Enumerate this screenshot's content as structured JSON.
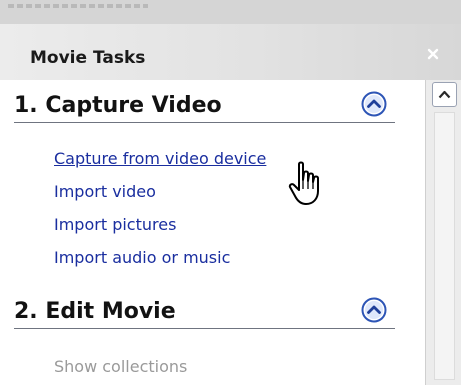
{
  "panel": {
    "title": "Movie Tasks",
    "close_glyph": "×"
  },
  "sections": [
    {
      "title": "1. Capture Video",
      "toggle_icon": "chevron-up-circle-icon",
      "tasks": [
        {
          "label": "Capture from video device",
          "state": "hover"
        },
        {
          "label": "Import video",
          "state": "normal"
        },
        {
          "label": "Import pictures",
          "state": "normal"
        },
        {
          "label": "Import audio or music",
          "state": "normal"
        }
      ]
    },
    {
      "title": "2. Edit Movie",
      "toggle_icon": "chevron-up-circle-icon",
      "tasks": [
        {
          "label": "Show collections",
          "state": "disabled"
        }
      ]
    }
  ],
  "colors": {
    "link": "#1a2e9f",
    "disabled_text": "#9a9a9a",
    "toggle_accent": "#2d55b6"
  },
  "icons": {
    "cursor": "hand-pointer-icon",
    "scroll_up": "arrow-up-icon"
  }
}
